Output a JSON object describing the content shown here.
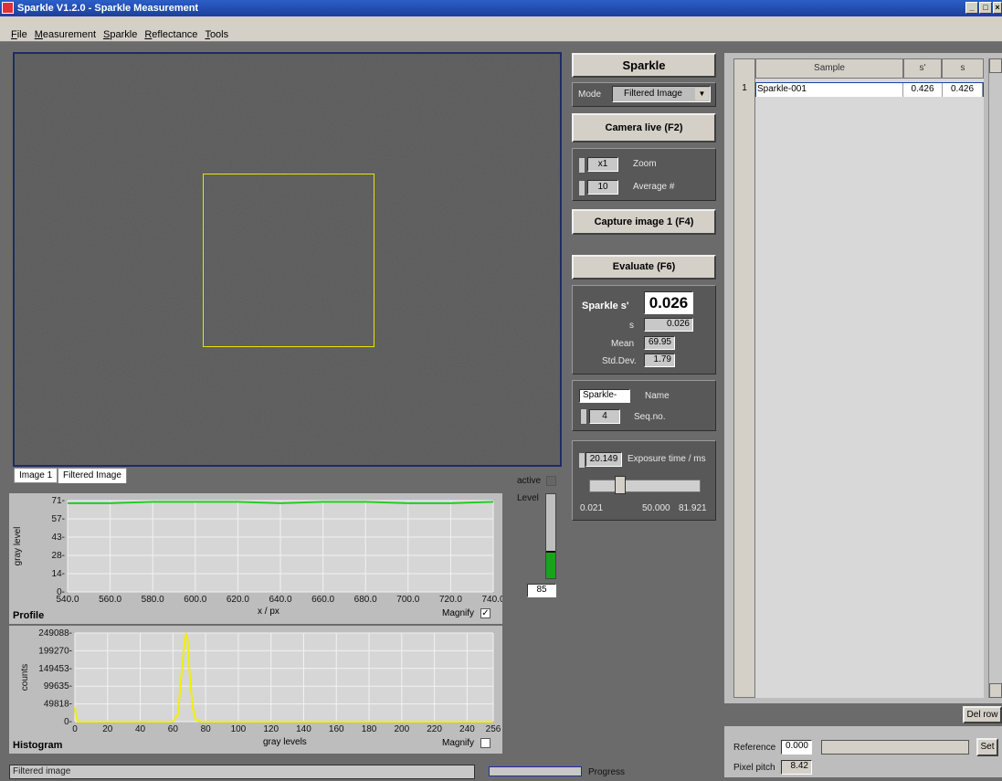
{
  "window": {
    "title": "Sparkle V1.2.0 - Sparkle Measurement"
  },
  "menu": [
    {
      "label": "File",
      "key": "F"
    },
    {
      "label": "Measurement",
      "key": "M"
    },
    {
      "label": "Sparkle",
      "key": "S"
    },
    {
      "label": "Reflectance",
      "key": "R"
    },
    {
      "label": "Tools",
      "key": "T"
    }
  ],
  "image_tabs": [
    "Image 1",
    "Filtered Image"
  ],
  "active_label": "active",
  "level": {
    "label": "Level",
    "value": "85",
    "fill_fraction": 0.33
  },
  "controls": {
    "sparkle_button": "Sparkle",
    "mode_label": "Mode",
    "mode_value": "Filtered Image",
    "camera_live_button": "Camera live (F2)",
    "zoom_value": "x1",
    "zoom_label": "Zoom",
    "average_value": "10",
    "average_label": "Average #",
    "capture_button": "Capture image 1 (F4)",
    "evaluate_button": "Evaluate (F6)"
  },
  "results": {
    "sparkle_s_label": "Sparkle s'",
    "sparkle_s_value": "0.026",
    "s_label": "s",
    "s_value": "0.026",
    "mean_label": "Mean",
    "mean_value": "69.95",
    "std_label": "Std.Dev.",
    "std_value": "1.79"
  },
  "naming": {
    "name_value": "Sparkle-",
    "name_label": "Name",
    "seq_value": "4",
    "seq_label": "Seq.no."
  },
  "exposure": {
    "value": "20.149",
    "label": "Exposure time / ms",
    "min_label": "0.021",
    "mid_label": "50.000",
    "max_label": "81.921",
    "slider_fraction": 0.25
  },
  "table": {
    "columns": [
      "Sample",
      "s'",
      "s"
    ],
    "rows": [
      {
        "index": "1",
        "sample": "Sparkle-001",
        "s_prime": "0.426",
        "s": "0.426"
      }
    ],
    "del_row_button": "Del row"
  },
  "reference": {
    "label": "Reference",
    "value": "0.000",
    "set_button": "Set",
    "pixel_pitch_label": "Pixel pitch",
    "pixel_pitch_value": "8.42"
  },
  "status": {
    "text": "Filtered image",
    "progress_label": "Progress"
  },
  "colors": {
    "roi": "#e6e600",
    "profile_line": "#22cc22",
    "histogram_line": "#f0f000",
    "level_fill": "#1aa31a"
  },
  "chart_data": [
    {
      "type": "line",
      "title": "Profile",
      "xlabel": "x / px",
      "ylabel": "gray level",
      "xlim": [
        540,
        740
      ],
      "ylim": [
        0,
        71
      ],
      "x_ticks": [
        "540.0",
        "560.0",
        "580.0",
        "600.0",
        "620.0",
        "640.0",
        "660.0",
        "680.0",
        "700.0",
        "720.0",
        "740.0"
      ],
      "y_ticks": [
        "71",
        "57",
        "43",
        "28",
        "14",
        "0"
      ],
      "magnify_label": "Magnify",
      "magnify_checked": true,
      "series": [
        {
          "x": [
            540,
            560,
            580,
            600,
            620,
            640,
            660,
            680,
            700,
            720,
            740
          ],
          "y": [
            69,
            69,
            70,
            70,
            70,
            69,
            70,
            70,
            69,
            69,
            70
          ]
        }
      ]
    },
    {
      "type": "line",
      "title": "Histogram",
      "xlabel": "gray levels",
      "ylabel": "counts",
      "xlim": [
        0,
        256
      ],
      "ylim": [
        0,
        249088
      ],
      "x_ticks": [
        "0",
        "20",
        "40",
        "60",
        "80",
        "100",
        "120",
        "140",
        "160",
        "180",
        "200",
        "220",
        "240",
        "256"
      ],
      "y_ticks": [
        "249088",
        "199270",
        "149453",
        "99635",
        "49818",
        "0"
      ],
      "magnify_label": "Magnify",
      "magnify_checked": false,
      "series": [
        {
          "x": [
            0,
            1,
            2,
            60,
            63,
            65,
            67,
            68,
            69,
            70,
            72,
            74,
            77,
            256
          ],
          "y": [
            40000,
            10000,
            0,
            0,
            20000,
            120000,
            220000,
            249088,
            230000,
            150000,
            40000,
            5000,
            0,
            0
          ]
        }
      ]
    }
  ]
}
